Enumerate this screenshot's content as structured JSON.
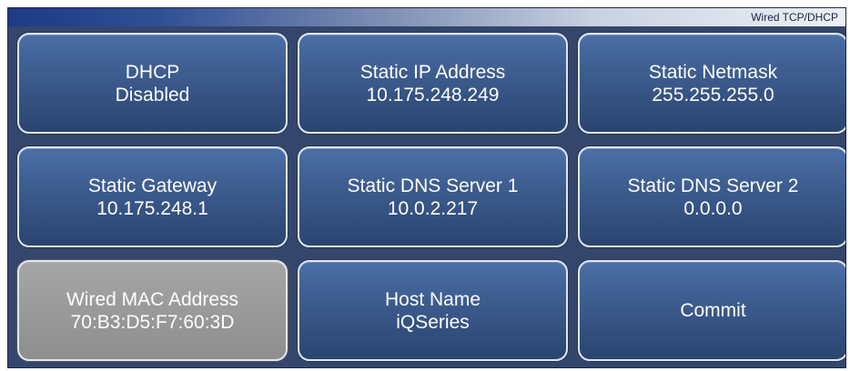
{
  "header": {
    "title": "Wired TCP/DHCP"
  },
  "buttons": [
    {
      "label": "DHCP",
      "value": "Disabled"
    },
    {
      "label": "Static IP Address",
      "value": "10.175.248.249"
    },
    {
      "label": "Static Netmask",
      "value": "255.255.255.0"
    },
    {
      "label": "Static Gateway",
      "value": "10.175.248.1"
    },
    {
      "label": "Static DNS Server 1",
      "value": "10.0.2.217"
    },
    {
      "label": "Static DNS Server 2",
      "value": "0.0.0.0"
    },
    {
      "label": "Wired MAC Address",
      "value": "70:B3:D5:F7:60:3D",
      "enabled": false
    },
    {
      "label": "Host Name",
      "value": "iQSeries"
    },
    {
      "label": "Commit"
    }
  ],
  "colors": {
    "button_blue": "#3f5f92",
    "button_disabled_gray": "#9a9a9a",
    "screen_background": "#34466b"
  }
}
